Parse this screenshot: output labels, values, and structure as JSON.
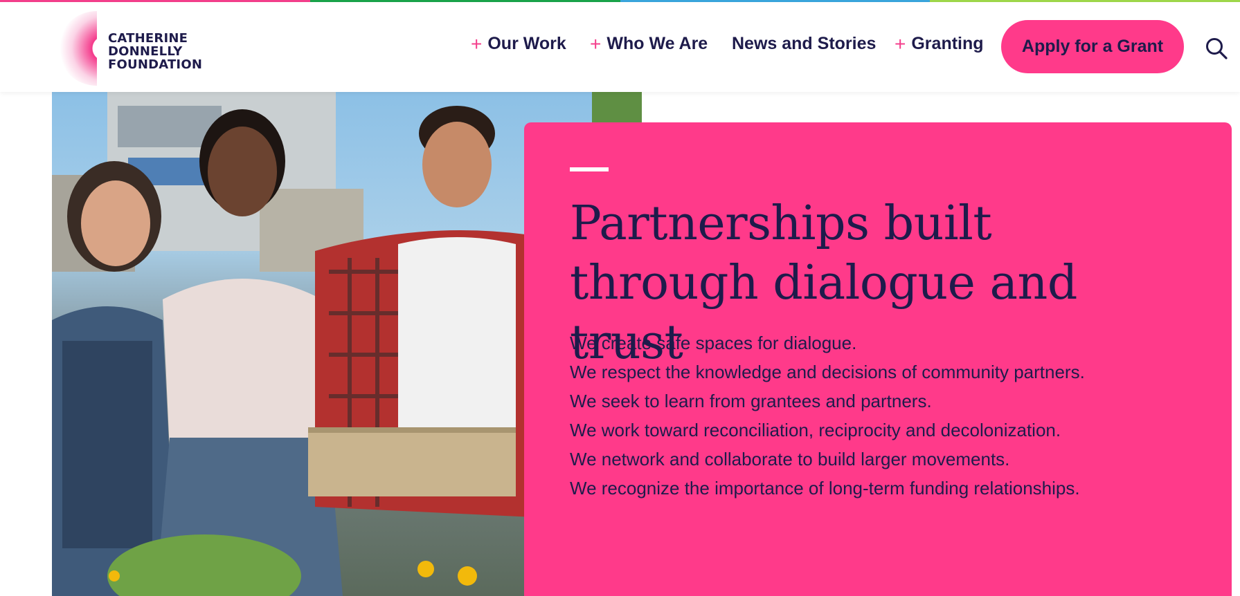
{
  "colors": {
    "brand_pink": "#ff3a8a",
    "navy": "#1e1b4b",
    "strip": [
      "#f43f8c",
      "#1aa44a",
      "#3aa6dd",
      "#9fd84a"
    ]
  },
  "logo": {
    "line1": "CATHERINE",
    "line2": "DONNELLY",
    "line3": "FOUNDATION"
  },
  "nav": {
    "items": [
      {
        "label": "Our Work",
        "expandable": true
      },
      {
        "label": "Who We Are",
        "expandable": true
      },
      {
        "label": "News and Stories",
        "expandable": false
      },
      {
        "label": "Granting",
        "expandable": true
      }
    ],
    "plus": "+",
    "apply_button": "Apply for a Grant",
    "search_icon": "search-icon"
  },
  "hero": {
    "title": "Partnerships built through dialogue and trust",
    "values": [
      "We create safe spaces for dialogue.",
      "We respect the knowledge and decisions of community partners.",
      "We seek to learn from grantees and partners.",
      "We work toward reconciliation, reciprocity and decolonization.",
      "We network and collaborate to build larger movements.",
      "We recognize the importance of long-term funding relationships."
    ]
  }
}
